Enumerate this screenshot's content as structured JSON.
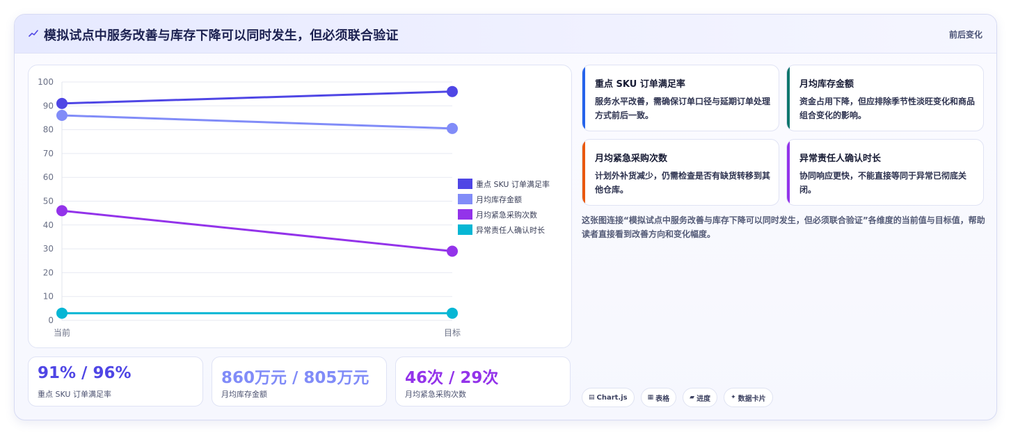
{
  "header": {
    "title": "模拟试点中服务改善与库存下降可以同时发生，但必须联合验证",
    "link": "前后变化"
  },
  "chart_data": {
    "type": "line",
    "categories": [
      "当前",
      "目标"
    ],
    "ylim": [
      0,
      100
    ],
    "yticks": [
      0,
      10,
      20,
      30,
      40,
      50,
      60,
      70,
      80,
      90,
      100
    ],
    "grid": true,
    "legend_position": "right",
    "series": [
      {
        "name": "重点 SKU 订单满足率",
        "values": [
          91,
          96
        ],
        "color": "#4f46e5"
      },
      {
        "name": "月均库存金额",
        "values": [
          86,
          80.5
        ],
        "color": "#818cf8"
      },
      {
        "name": "月均紧急采购次数",
        "values": [
          46,
          29
        ],
        "color": "#9333ea"
      },
      {
        "name": "异常责任人确认时长",
        "values": [
          3,
          3
        ],
        "color": "#06b6d4"
      }
    ]
  },
  "stats": [
    {
      "value": "91% / 96%",
      "label": "重点 SKU 订单满足率",
      "color": "#4f46e5"
    },
    {
      "value": "860万元 / 805万元",
      "label": "月均库存金额",
      "color": "#818cf8"
    },
    {
      "value": "46次 / 29次",
      "label": "月均紧急采购次数",
      "color": "#9333ea"
    }
  ],
  "notes": [
    {
      "title": "重点 SKU 订单满足率",
      "text": "服务水平改善，需确保订单口径与延期订单处理方式前后一致。",
      "color": "#2563eb"
    },
    {
      "title": "月均库存金额",
      "text": "资金占用下降，但应排除季节性淡旺变化和商品组合变化的影响。",
      "color": "#0f766e"
    },
    {
      "title": "月均紧急采购次数",
      "text": "计划外补货减少，仍需检查是否有缺货转移到其他仓库。",
      "color": "#ea580c"
    },
    {
      "title": "异常责任人确认时长",
      "text": "协同响应更快，不能直接等同于异常已彻底关闭。",
      "color": "#9333ea"
    }
  ],
  "description": "这张图连接“模拟试点中服务改善与库存下降可以同时发生，但必须联合验证”各维度的当前值与目标值，帮助读者直接看到改善方向和变化幅度。",
  "chips": [
    {
      "icon": "chart-icon",
      "glyph": "▤",
      "label": "Chart.js"
    },
    {
      "icon": "table-icon",
      "glyph": "▦",
      "label": "表格"
    },
    {
      "icon": "progress-icon",
      "glyph": "▰",
      "label": "进度"
    },
    {
      "icon": "sparkle-icon",
      "glyph": "✦",
      "label": "数据卡片"
    }
  ]
}
